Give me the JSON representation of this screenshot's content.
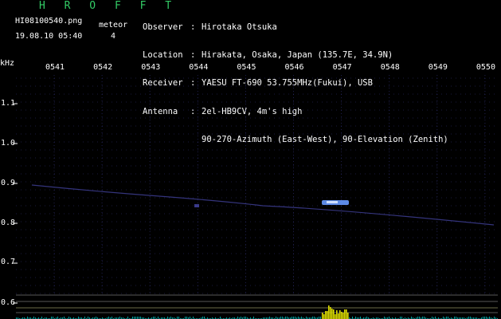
{
  "header": {
    "app_name": "H R O F F T",
    "filename": "HI08100540.png",
    "timestamp": "19.08.10 05:40",
    "meteor_label": "meteor",
    "meteor_count": "4"
  },
  "info": [
    {
      "label": "Observer",
      "value": "Hirotaka Otsuka"
    },
    {
      "label": "Location",
      "value": "Hirakata, Osaka, Japan (135.7E, 34.9N)"
    },
    {
      "label": "Receiver",
      "value": "YAESU FT-690 53.755MHz(Fukui), USB"
    },
    {
      "label": "Antenna",
      "value": "2el-HB9CV, 4m's high"
    },
    {
      "label": "",
      "value": "90-270-Azimuth (East-West), 90-Elevation (Zenith)"
    }
  ],
  "axes": {
    "y_unit": "kHz",
    "y_ticks": [
      "1.1",
      "1.0",
      "0.9",
      "0.8",
      "0.7",
      "0.6"
    ],
    "x_ticks": [
      "0541",
      "0542",
      "0543",
      "0544",
      "0545",
      "0546",
      "0547",
      "0548",
      "0549",
      "0550"
    ]
  },
  "colors": {
    "background": "#000000",
    "logo": "#33cc66",
    "grid": "#3a3a8a",
    "echo": "#6699ff",
    "signal_yellow": "#dddd00",
    "signal_cyan": "#00aaaa",
    "line": "#aaaaaa"
  }
}
